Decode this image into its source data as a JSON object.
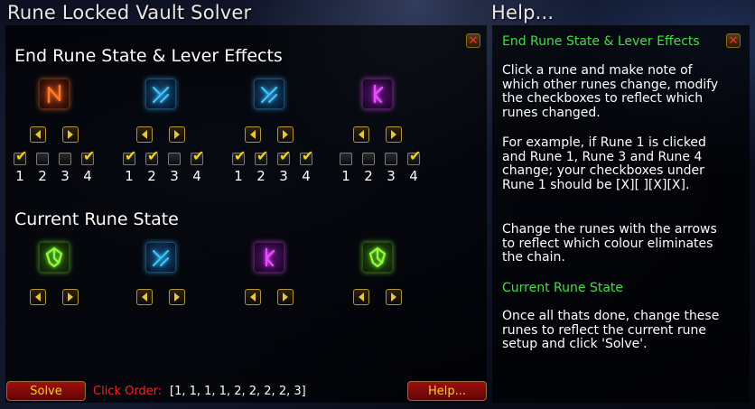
{
  "window": {
    "title": "Rune Locked Vault Solver",
    "help_title": "Help..."
  },
  "colors": {
    "orange": "#ff7a28",
    "blue": "#3cc4ff",
    "purple": "#e84cff",
    "green": "#8cff3c",
    "help_heading": "#40e040",
    "click_order_label": "#ff2020",
    "button_text": "#f5d020"
  },
  "end_section": {
    "title": "End Rune State & Lever Effects",
    "runes": [
      {
        "color": "orange",
        "icon": "rune-orange-icon",
        "checks": [
          true,
          false,
          false,
          true
        ]
      },
      {
        "color": "blue",
        "icon": "rune-blue-icon",
        "checks": [
          true,
          true,
          false,
          true
        ]
      },
      {
        "color": "blue",
        "icon": "rune-blue-icon",
        "checks": [
          true,
          true,
          true,
          true
        ]
      },
      {
        "color": "purple",
        "icon": "rune-purple-icon",
        "checks": [
          false,
          false,
          false,
          true
        ]
      }
    ],
    "numbers": [
      "1",
      "2",
      "3",
      "4"
    ]
  },
  "current_section": {
    "title": "Current Rune State",
    "runes": [
      {
        "color": "green",
        "icon": "rune-green-icon"
      },
      {
        "color": "blue",
        "icon": "rune-blue-icon"
      },
      {
        "color": "purple",
        "icon": "rune-purple-icon"
      },
      {
        "color": "green",
        "icon": "rune-green-icon"
      }
    ]
  },
  "help": {
    "heading1": "End Rune State & Lever Effects",
    "para1": "Click a rune and make note of which other runes change, modify the checkboxes to reflect which runes changed.",
    "para2": "For example, if Rune 1 is clicked and Rune 1, Rune 3 and Rune 4 change; your checkboxes under Rune 1 should be [X][ ][X][X].",
    "para3": "Change the runes with the arrows to reflect which colour eliminates the chain.",
    "heading2": "Current Rune State",
    "para4": "Once all thats done, change these runes to reflect the current rune setup and click 'Solve'."
  },
  "footer": {
    "solve_label": "Solve",
    "click_order_label": "Click Order:",
    "click_order_value": "[1, 1, 1, 1, 2, 2, 2, 2, 3]",
    "help_button_label": "Help..."
  },
  "icons": {
    "close": "close-icon",
    "left": "arrow-left-icon",
    "right": "arrow-right-icon",
    "check": "checkmark-icon"
  }
}
